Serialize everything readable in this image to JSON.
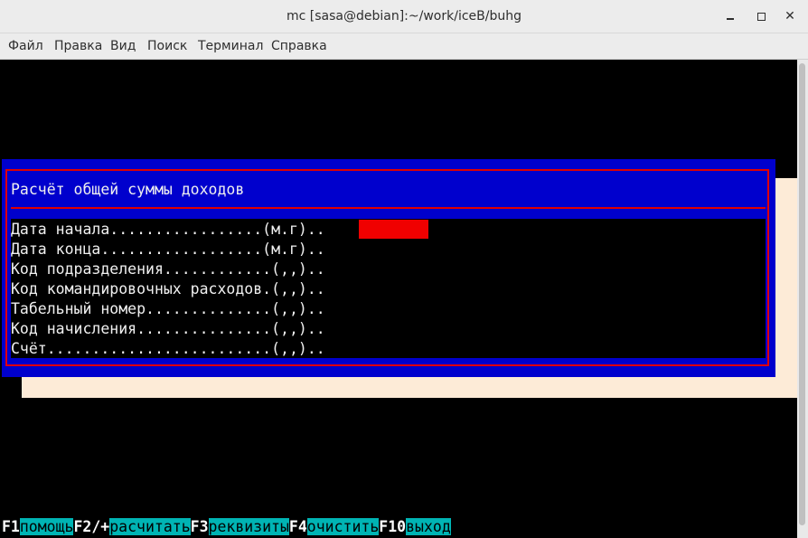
{
  "window": {
    "title": "mc [sasa@debian]:~/work/iceB/buhg",
    "min_glyph": "",
    "close_glyph": "✕"
  },
  "menu": [
    "Файл",
    "Правка",
    "Вид",
    "Поиск",
    "Терминал",
    "Справка"
  ],
  "dialog": {
    "title": "Расчёт общей суммы доходов",
    "fields": [
      "Дата начала.................(м.г)..",
      "Дата конца..................(м.г)..",
      "Код подразделения............(,,)..",
      "Код командировочных расходов.(,,)..",
      "Табельный номер..............(,,)..",
      "Код начисления...............(,,)..",
      "Счёт.........................(,,).."
    ],
    "active_field_value": ""
  },
  "fkeys": [
    {
      "key": "F1",
      "action": "помощь"
    },
    {
      "key": "F2/+",
      "action": "расчитать"
    },
    {
      "key": "F3",
      "action": "реквизиты"
    },
    {
      "key": "F4",
      "action": "очистить"
    },
    {
      "key": "F10",
      "action": "выход"
    }
  ],
  "colors": {
    "dialog_bg": "#0000cd",
    "dialog_border": "#e00000",
    "active_field": "#f00000",
    "shadow": "#fdebd7",
    "fkey_action_bg": "#00b4b4"
  }
}
